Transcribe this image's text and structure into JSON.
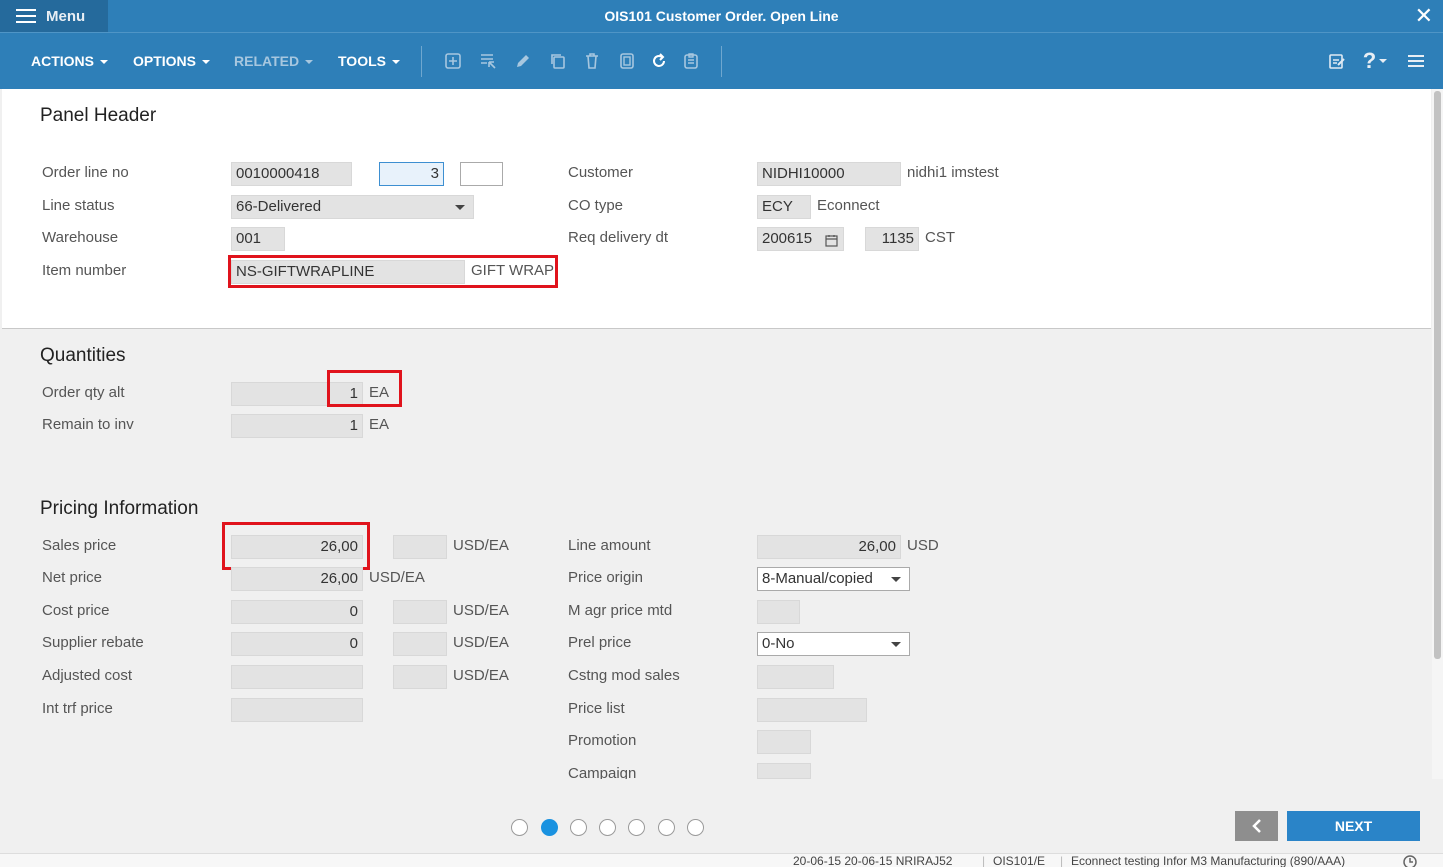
{
  "titlebar": {
    "menu_label": "Menu",
    "title": "OIS101 Customer Order. Open Line",
    "close": "✕"
  },
  "toolbar": {
    "actions": "ACTIONS",
    "options": "OPTIONS",
    "related": "RELATED",
    "tools": "TOOLS",
    "help": "?"
  },
  "header": {
    "title": "Panel Header",
    "order_line_no_label": "Order line no",
    "order_line_no": "0010000418",
    "line_suffix": "3",
    "line_status_label": "Line status",
    "line_status": "66-Delivered",
    "warehouse_label": "Warehouse",
    "warehouse": "001",
    "item_number_label": "Item number",
    "item_number": "NS-GIFTWRAPLINE",
    "item_desc": "GIFT WRAP",
    "customer_label": "Customer",
    "customer": "NIDHI10000",
    "customer_name": "nidhi1 imstest",
    "co_type_label": "CO type",
    "co_type": "ECY",
    "co_type_name": "Econnect",
    "req_delivery_label": "Req delivery dt",
    "req_delivery": "200615",
    "req_time": "1135",
    "timezone": "CST"
  },
  "quantities": {
    "title": "Quantities",
    "order_qty_label": "Order qty alt",
    "order_qty": "1",
    "order_qty_unit": "EA",
    "remain_label": "Remain to inv",
    "remain": "1",
    "remain_unit": "EA"
  },
  "pricing": {
    "title": "Pricing Information",
    "sales_price_label": "Sales price",
    "sales_price": "26,00",
    "sales_unit": "USD/EA",
    "net_price_label": "Net price",
    "net_price": "26,00",
    "net_unit": "USD/EA",
    "cost_price_label": "Cost price",
    "cost_price": "0",
    "cost_unit": "USD/EA",
    "supplier_rebate_label": "Supplier rebate",
    "supplier_rebate": "0",
    "rebate_unit": "USD/EA",
    "adjusted_cost_label": "Adjusted cost",
    "adjusted_unit": "USD/EA",
    "int_trf_label": "Int trf price",
    "line_amount_label": "Line amount",
    "line_amount": "26,00",
    "line_amount_currency": "USD",
    "price_origin_label": "Price origin",
    "price_origin": "8-Manual/copied",
    "m_agr_label": "M agr price mtd",
    "prel_price_label": "Prel price",
    "prel_price": "0-No",
    "cstng_label": "Cstng mod sales",
    "price_list_label": "Price list",
    "promotion_label": "Promotion",
    "campaign_label": "Campaign"
  },
  "footer": {
    "next_label": "NEXT",
    "page_count": 7,
    "active_page": 2
  },
  "statusbar": {
    "dates": "20-06-15 20-06-15 NRIRAJ52",
    "program": "OIS101/E",
    "company": "Econnect testing Infor M3 Manufacturing (890/AAA)"
  },
  "colors": {
    "brand": "#2e7fb8",
    "highlight": "#e0131c",
    "next": "#2a84c8"
  }
}
